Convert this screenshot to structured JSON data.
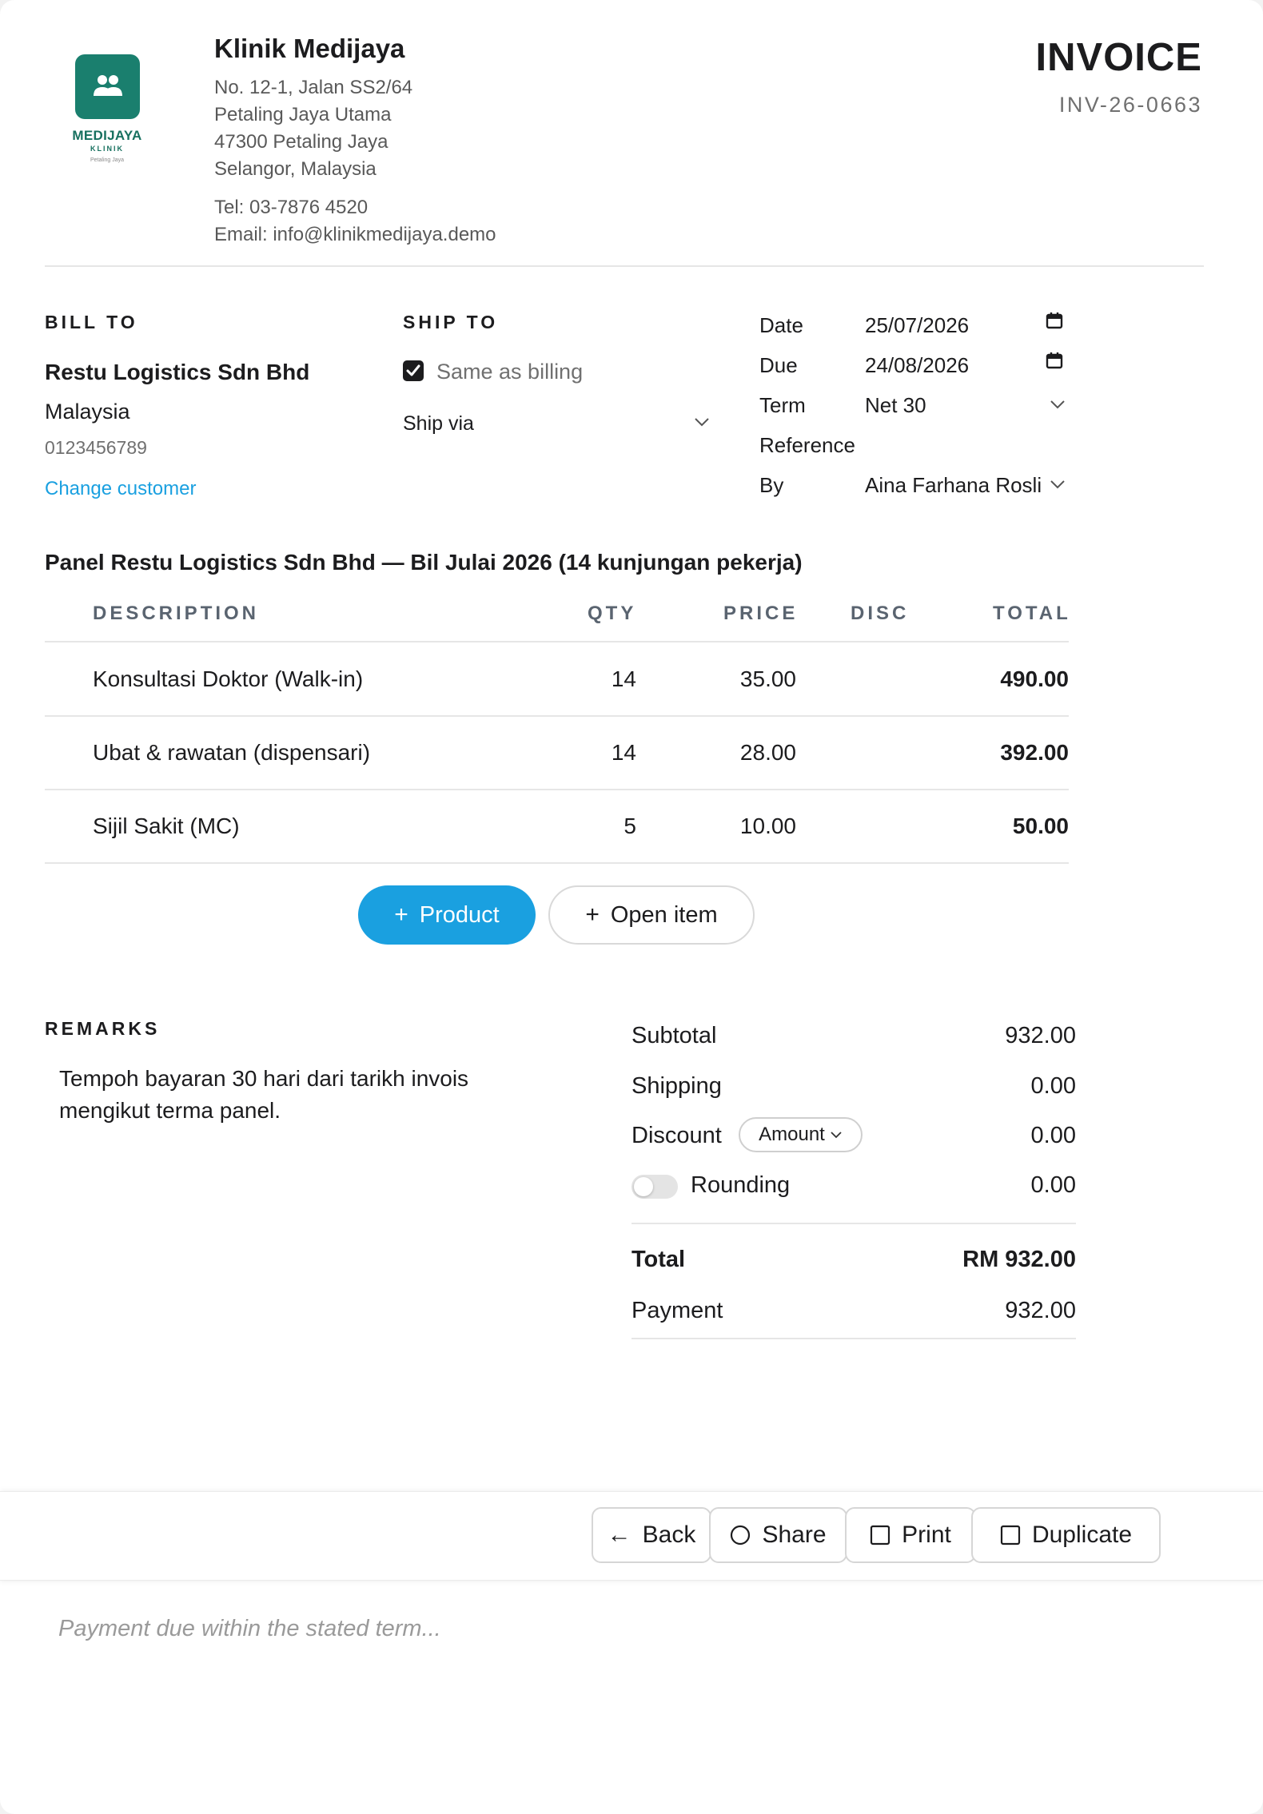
{
  "clinic": {
    "logo_name": "MEDIJAYA",
    "logo_sub": "KLINIK",
    "logo_location": "Petaling Jaya",
    "name": "Klinik Medijaya",
    "address_lines": [
      "No. 12-1, Jalan SS2/64",
      "Petaling Jaya Utama",
      "47300 Petaling Jaya",
      "Selangor, Malaysia"
    ],
    "tel": "Tel: 03-7876 4520",
    "email": "Email: info@klinikmedijaya.demo"
  },
  "invoice": {
    "title": "INVOICE",
    "number": "INV-26-0663"
  },
  "bill_to": {
    "label": "BILL TO",
    "customer": "Restu Logistics Sdn Bhd",
    "country": "Malaysia",
    "phone": "0123456789",
    "change_link": "Change customer"
  },
  "ship_to": {
    "label": "SHIP TO",
    "same_as_billing_label": "Same as billing",
    "same_as_billing_checked": true,
    "ship_via_label": "Ship via"
  },
  "meta": {
    "date_label": "Date",
    "date_value": "25/07/2026",
    "due_label": "Due",
    "due_value": "24/08/2026",
    "term_label": "Term",
    "term_value": "Net 30",
    "reference_label": "Reference",
    "by_label": "By",
    "by_value": "Aina Farhana Rosli"
  },
  "items_title": "Panel Restu Logistics Sdn Bhd — Bil Julai 2026 (14 kunjungan pekerja)",
  "table": {
    "headers": {
      "description": "DESCRIPTION",
      "qty": "QTY",
      "price": "PRICE",
      "disc": "DISC",
      "total": "TOTAL"
    },
    "rows": [
      {
        "description": "Konsultasi Doktor (Walk-in)",
        "qty": "14",
        "price": "35.00",
        "disc": "",
        "total": "490.00"
      },
      {
        "description": "Ubat & rawatan (dispensari)",
        "qty": "14",
        "price": "28.00",
        "disc": "",
        "total": "392.00"
      },
      {
        "description": "Sijil Sakit (MC)",
        "qty": "5",
        "price": "10.00",
        "disc": "",
        "total": "50.00"
      }
    ]
  },
  "actions": {
    "add_product": "Product",
    "add_open_item": "Open item"
  },
  "remarks": {
    "label": "REMARKS",
    "lines": [
      "Tempoh bayaran 30 hari dari tarikh invois",
      "mengikut terma panel."
    ]
  },
  "summary": {
    "subtotal_label": "Subtotal",
    "subtotal": "932.00",
    "shipping_label": "Shipping",
    "shipping": "0.00",
    "discount_label": "Discount",
    "discount_mode": "Amount",
    "discount": "0.00",
    "rounding_label": "Rounding",
    "rounding_enabled": false,
    "rounding": "0.00",
    "total_label": "Total",
    "total": "RM 932.00",
    "payment_label": "Payment",
    "payment": "932.00"
  },
  "footer": {
    "back_label": "Back",
    "share_label": "Share",
    "print_label": "Print",
    "duplicate_label": "Duplicate",
    "note_placeholder": "Payment due within the stated term..."
  },
  "colors": {
    "brand": "#1a7f6e",
    "accent": "#1aa0e0",
    "text": "#1c1c1e",
    "muted": "#707070"
  }
}
